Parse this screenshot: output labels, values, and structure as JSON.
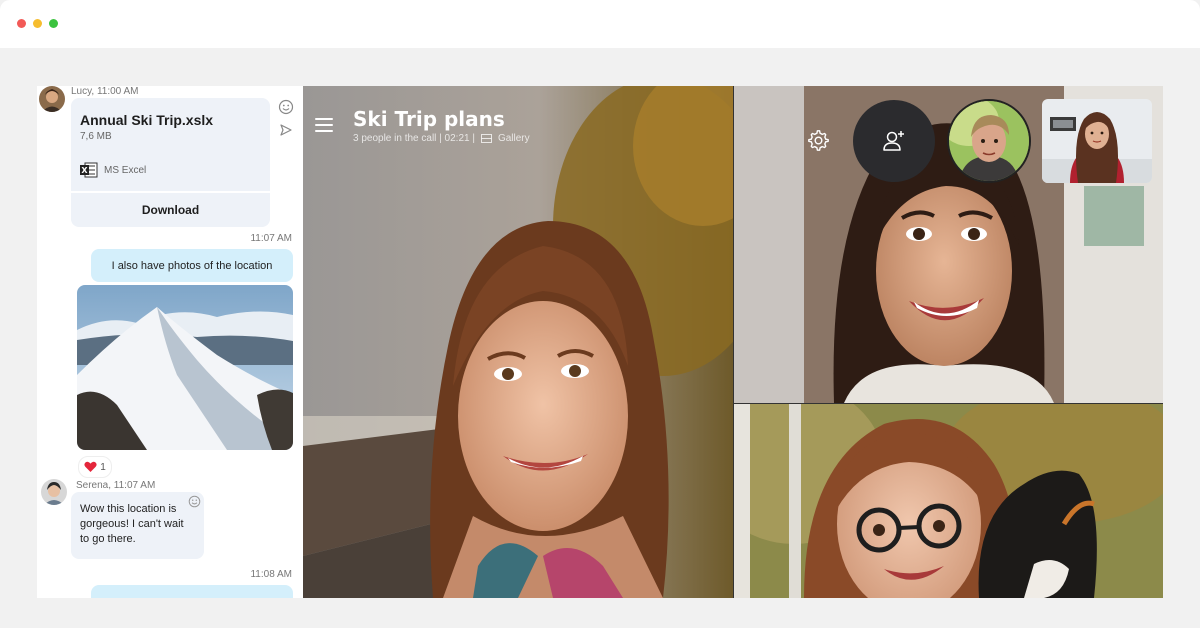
{
  "window": {
    "controls": [
      "close",
      "minimize",
      "maximize"
    ]
  },
  "chat": {
    "file_message": {
      "sender_meta": "Lucy, 11:00 AM",
      "file_name": "Annual Ski Trip.xslx",
      "file_size": "7,6 MB",
      "file_type": "MS Excel",
      "download_label": "Download"
    },
    "msg1": {
      "time": "11:07 AM",
      "text": "I also have photos of the location"
    },
    "reaction": {
      "icon": "heart-icon",
      "count": "1"
    },
    "msg2": {
      "sender_meta": "Serena, 11:07 AM",
      "text": "Wow this location is gorgeous! I can't wait to go there."
    },
    "msg3": {
      "time": "11:08 AM"
    }
  },
  "call": {
    "title": "Ski Trip plans",
    "subtitle": "3 people in the call | 02:21  |",
    "view_label": "Gallery"
  },
  "colors": {
    "accent_bubble": "#d4effb",
    "incoming_bubble": "#eef2f8",
    "call_button": "#2b2b2e"
  }
}
